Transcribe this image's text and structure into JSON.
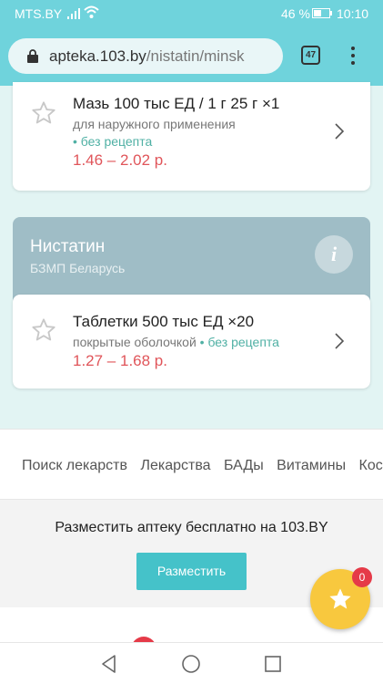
{
  "status_bar": {
    "carrier": "MTS.BY",
    "battery": "46 %",
    "time": "10:10"
  },
  "browser": {
    "url_domain": "apteka.103.by",
    "url_path": "/nistatin/minsk",
    "tab_count": "47"
  },
  "products": [
    {
      "name": "Мазь 100 тыс ЕД / 1 г 25 г ×1",
      "form": "для наружного применения",
      "rx": "• без рецепта",
      "price": "1.46 – 2.02 р."
    }
  ],
  "group": {
    "title": "Нистатин",
    "manufacturer": "БЗМП Беларусь",
    "info_icon": "i",
    "items": [
      {
        "name": "Таблетки 500 тыс ЕД ×20",
        "form": "покрытые оболочкой",
        "rx": "• без рецепта",
        "price": "1.27 – 1.68 р."
      }
    ]
  },
  "footer_links": [
    "Поиск лекарств",
    "Лекарства",
    "БАДы",
    "Витамины",
    "Космети"
  ],
  "promo": {
    "text": "Разместить аптеку бесплатно на 103.BY",
    "button": "Разместить"
  },
  "favorites": {
    "count": "0"
  },
  "colors": {
    "accent": "#45c2c9",
    "price": "#e0555a",
    "rx": "#4fb0a4",
    "group_header": "#9fbdc6",
    "fab": "#f8c83e"
  }
}
